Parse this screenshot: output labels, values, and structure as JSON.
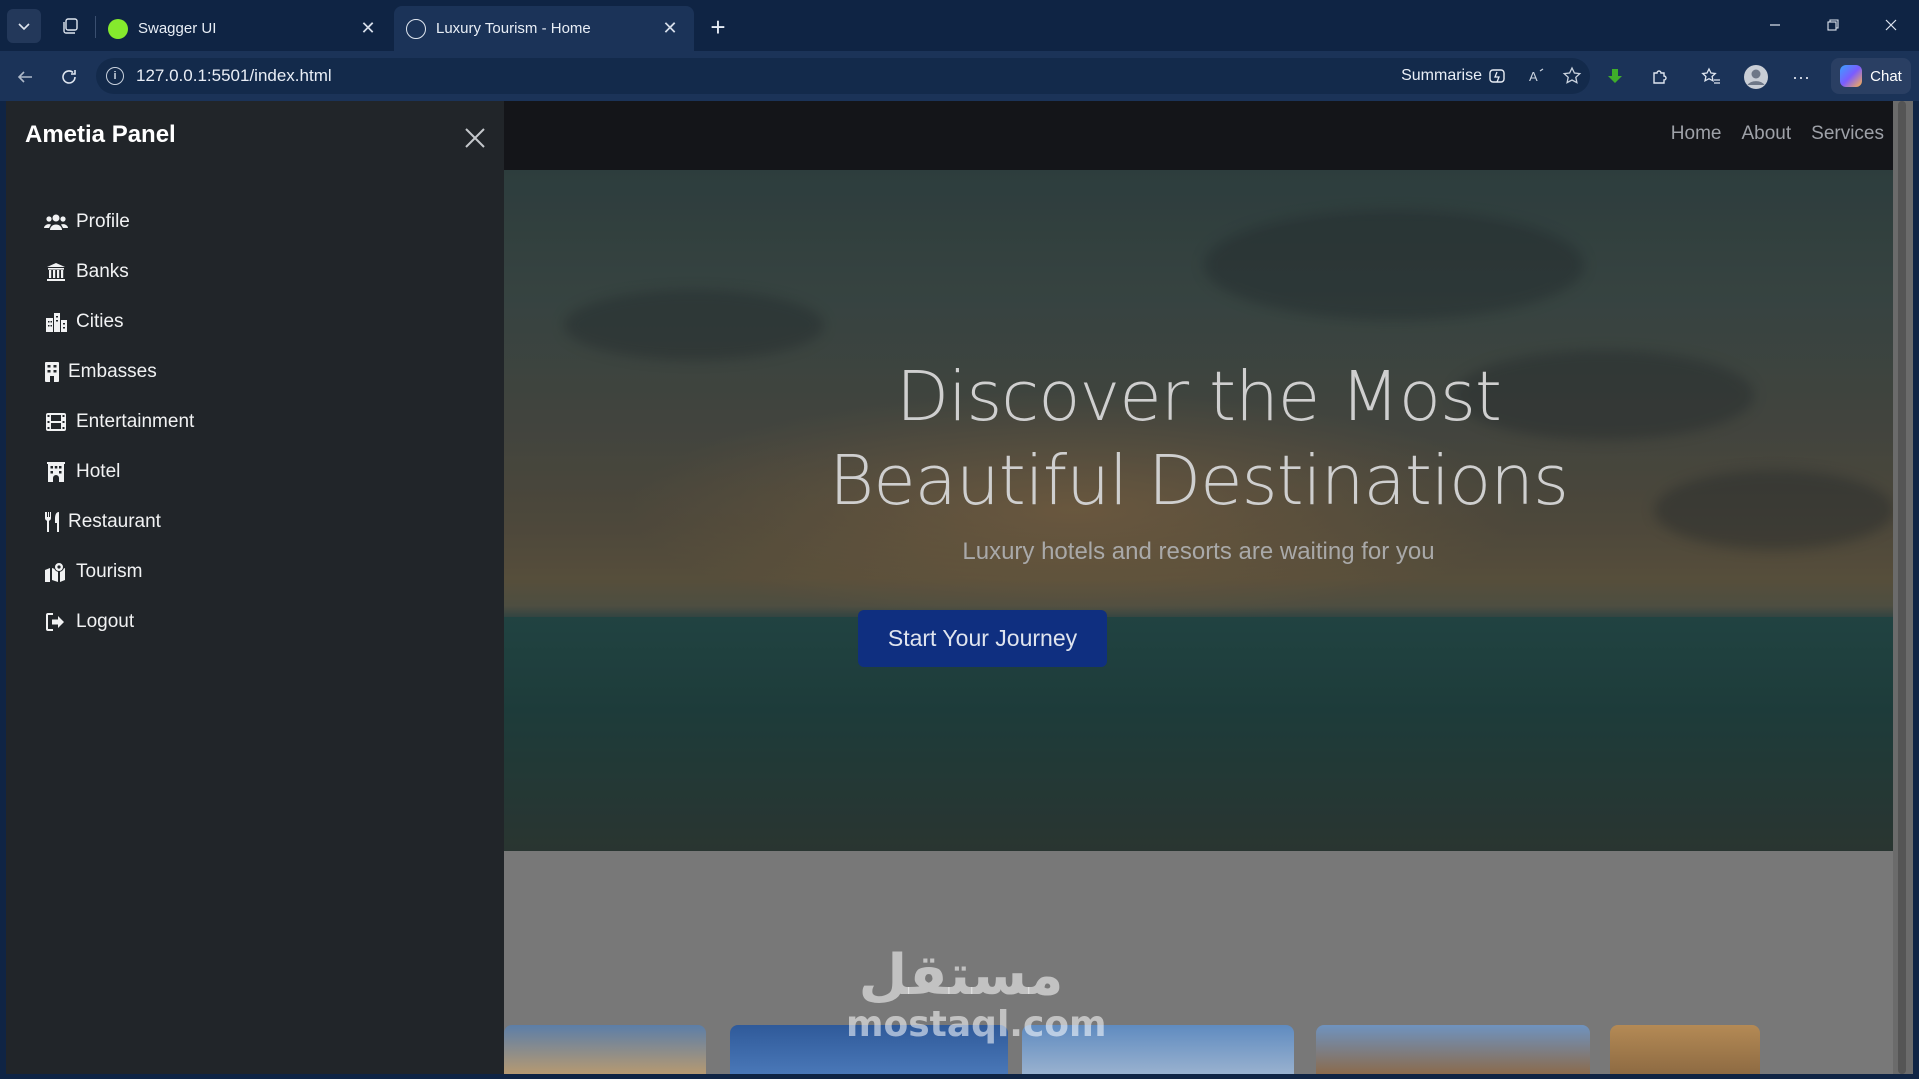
{
  "browser": {
    "tabs": [
      {
        "title": "Swagger UI",
        "active": false
      },
      {
        "title": "Luxury Tourism - Home",
        "active": true
      }
    ],
    "url": "127.0.0.1:5501/index.html",
    "summarise_label": "Summarise",
    "chat_label": "Chat"
  },
  "sidebar": {
    "title": "Ametia Panel",
    "items": [
      {
        "label": "Profile",
        "icon": "users-icon"
      },
      {
        "label": "Banks",
        "icon": "bank-icon"
      },
      {
        "label": "Cities",
        "icon": "city-icon"
      },
      {
        "label": "Embasses",
        "icon": "building-icon"
      },
      {
        "label": "Entertainment",
        "icon": "film-icon"
      },
      {
        "label": "Hotel",
        "icon": "hotel-icon"
      },
      {
        "label": "Restaurant",
        "icon": "utensils-icon"
      },
      {
        "label": "Tourism",
        "icon": "map-location-icon"
      },
      {
        "label": "Logout",
        "icon": "logout-icon"
      }
    ]
  },
  "navbar": {
    "links": [
      "Home",
      "About",
      "Services"
    ]
  },
  "hero": {
    "title_line1": "Discover the Most",
    "title_line2": "Beautiful Destinations",
    "subtitle": "Luxury hotels and resorts are waiting for you",
    "cta": "Start Your Journey"
  },
  "watermark": {
    "arabic": "مستقل",
    "latin": "mostaql.com"
  },
  "colors": {
    "chrome_bg": "#0f2444",
    "sidebar_bg": "#212529",
    "navbar_bg": "#141519",
    "cta_bg": "#0f2f80"
  }
}
